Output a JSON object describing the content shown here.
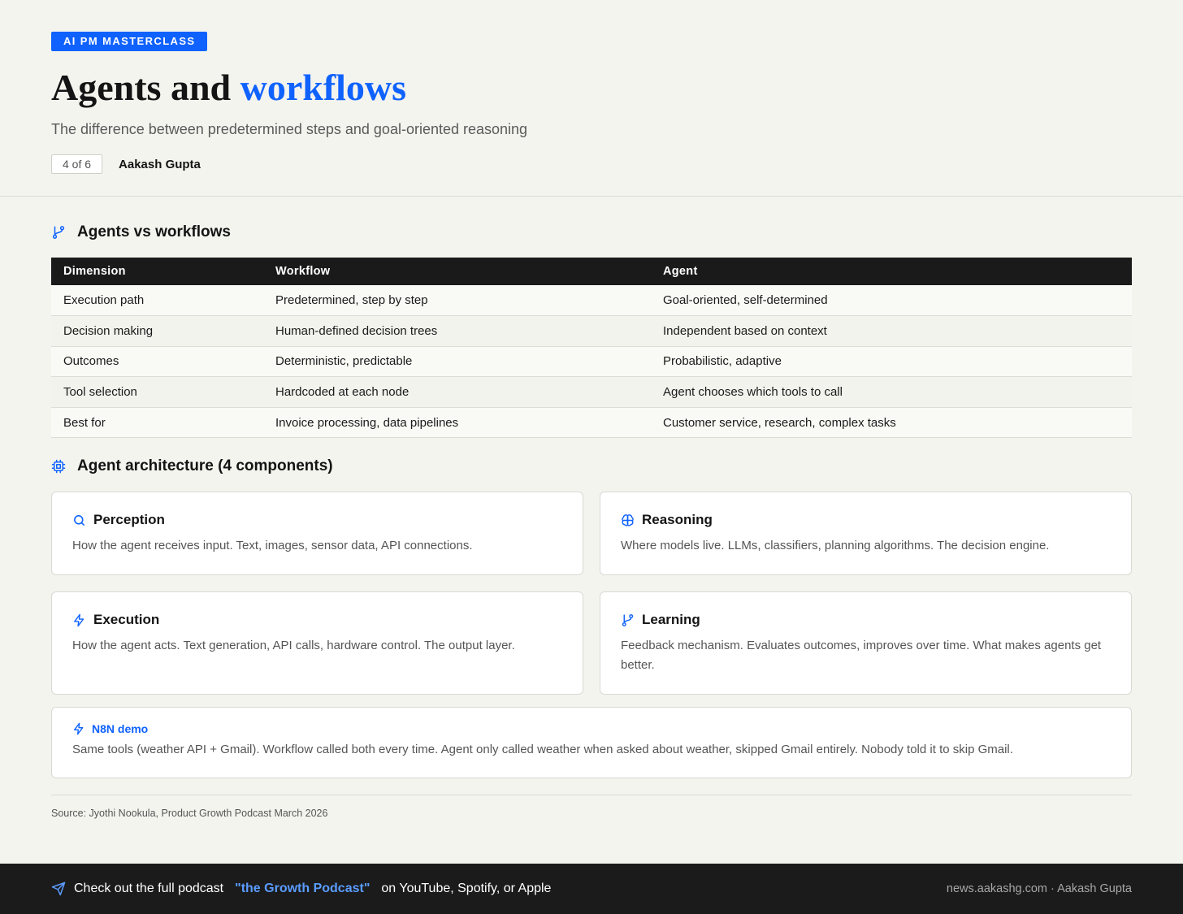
{
  "header": {
    "badge": "AI PM MASTERCLASS",
    "title_plain": "Agents and",
    "title_accent": "workflows",
    "subtitle": "The difference between predetermined steps and goal-oriented reasoning",
    "pager": "4 of 6",
    "author": "Aakash Gupta"
  },
  "comparison": {
    "heading": "Agents vs workflows",
    "icon": "git-branch-icon",
    "columns": [
      "Dimension",
      "Workflow",
      "Agent"
    ],
    "rows": [
      [
        "Execution path",
        "Predetermined, step by step",
        "Goal-oriented, self-determined"
      ],
      [
        "Decision making",
        "Human-defined decision trees",
        "Independent based on context"
      ],
      [
        "Outcomes",
        "Deterministic, predictable",
        "Probabilistic, adaptive"
      ],
      [
        "Tool selection",
        "Hardcoded at each node",
        "Agent chooses which tools to call"
      ],
      [
        "Best for",
        "Invoice processing, data pipelines",
        "Customer service, research, complex tasks"
      ]
    ]
  },
  "architecture": {
    "heading": "Agent architecture (4 components)",
    "icon": "cpu-chip-icon",
    "cards": [
      {
        "title": "Perception",
        "icon": "search-icon",
        "text": "How the agent receives input. Text, images, sensor data, API connections."
      },
      {
        "title": "Reasoning",
        "icon": "brain-icon",
        "text": "Where models live. LLMs, classifiers, planning algorithms. The decision engine."
      },
      {
        "title": "Execution",
        "icon": "lightning-icon",
        "text": "How the agent acts. Text generation, API calls, hardware control. The output layer."
      },
      {
        "title": "Learning",
        "icon": "git-branch-icon",
        "text": "Feedback mechanism. Evaluates outcomes, improves over time. What makes agents get better."
      }
    ]
  },
  "demo": {
    "title": "N8N demo",
    "icon": "lightning-icon",
    "text": "Same tools (weather API + Gmail). Workflow called both every time. Agent only called weather when asked about weather, skipped Gmail entirely. Nobody told it to skip Gmail."
  },
  "source": "Source: Jyothi Nookula, Product Growth Podcast March 2026",
  "footer": {
    "icon": "send-icon",
    "prefix": "Check out the full podcast",
    "link": "\"the Growth Podcast\"",
    "suffix": "on YouTube, Spotify, or Apple",
    "right": "news.aakashg.com · Aakash Gupta"
  },
  "colors": {
    "accent": "#0f62fe",
    "background": "#f4f4ef",
    "dark": "#1a1a1a",
    "footer_link": "#5b9cff"
  }
}
